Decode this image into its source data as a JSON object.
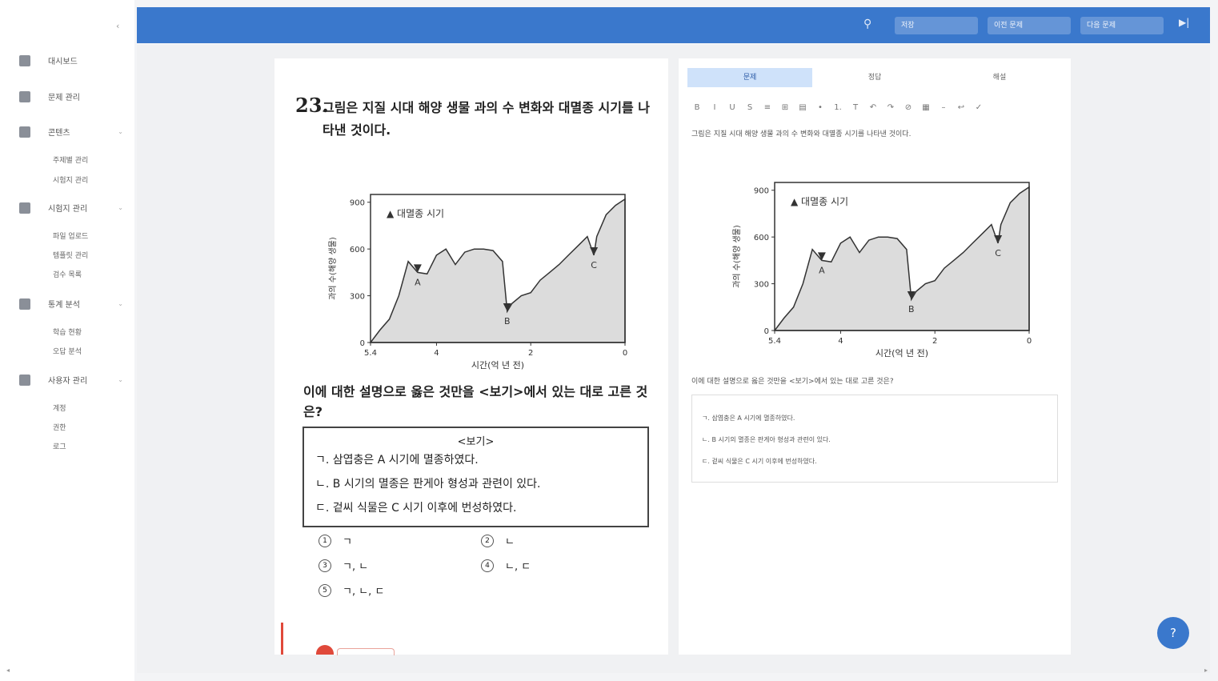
{
  "sidebar": {
    "collapse_glyph": "‹",
    "sections": [
      {
        "label": "대시보드",
        "icon": "dashboard-icon"
      },
      {
        "label": "문제 관리",
        "icon": "user-icon",
        "arrow": ""
      },
      {
        "label": "콘텐츠",
        "icon": "content-icon",
        "arrow": "⌄",
        "subs": [
          "주제별 관리",
          "시험지 관리"
        ]
      },
      {
        "label": "시험지 관리",
        "icon": "document-icon",
        "arrow": "⌄",
        "subs": [
          "파일 업로드",
          "템플릿 관리",
          "검수 목록"
        ]
      },
      {
        "label": "통계 분석",
        "icon": "chart-icon",
        "arrow": "⌄",
        "subs": [
          "학습 현황",
          "오답 분석"
        ]
      },
      {
        "label": "사용자 관리",
        "icon": "settings-icon",
        "arrow": "⌄",
        "subs": [
          "계정",
          "권한",
          "로그"
        ]
      }
    ]
  },
  "topbar": {
    "search_icon": "⚲",
    "buttons": [
      "저장",
      "이전 문제",
      "다음 문제"
    ],
    "next_glyph": "▶|"
  },
  "question": {
    "number": "23.",
    "text": "그림은 지질 시대 해양 생물 과의 수 변화와 대멸종 시기를 나타낸 것이다.",
    "prompt": "이에 대한 설명으로 옳은 것만을 <보기>에서 있는 대로 고른 것은?",
    "box_title": "<보기>",
    "box_lines": [
      "ㄱ. 삼엽충은 A 시기에 멸종하였다.",
      "ㄴ. B 시기의 멸종은 판게아 형성과 관련이 있다.",
      "ㄷ. 겉씨 식물은 C 시기 이후에 번성하였다."
    ],
    "options": [
      {
        "num": "1",
        "text": "ㄱ"
      },
      {
        "num": "2",
        "text": "ㄴ"
      },
      {
        "num": "3",
        "text": "ㄱ, ㄴ"
      },
      {
        "num": "4",
        "text": "ㄴ, ㄷ"
      },
      {
        "num": "5",
        "text": "ㄱ, ㄴ, ㄷ"
      }
    ]
  },
  "editor": {
    "tabs": [
      "문제",
      "정답",
      "해설"
    ],
    "toolbar": [
      "B",
      "I",
      "U",
      "S",
      "≡",
      "⊞",
      "▤",
      "•",
      "1.",
      "T",
      "↶",
      "↷",
      "⊘",
      "▦",
      "–",
      "↩",
      "✓"
    ],
    "body_text": "그림은 지질 시대 해양 생물 과의 수 변화와 대멸종 시기를 나타낸 것이다.",
    "prompt_text": "이에 대한 설명으로 옳은 것만을 <보기>에서 있는 대로 고른 것은?",
    "box_lines": [
      "ㄱ. 삼엽충은 A 시기에 멸종하였다.",
      "ㄴ. B 시기의 멸종은 판게아 형성과 관련이 있다.",
      "ㄷ. 겉씨 식물은 C 시기 이후에 번성하였다."
    ]
  },
  "fab_glyph": "?",
  "scroll_left": "◂",
  "scroll_right": "▸",
  "chart_data": [
    {
      "type": "area",
      "title": "",
      "legend": "▲ 대멸종 시기",
      "xlabel": "시간(억 년 전)",
      "ylabel": "과의 수(해양 생물)",
      "x": [
        5.4,
        5.2,
        5.0,
        4.8,
        4.6,
        4.4,
        4.2,
        4.0,
        3.8,
        3.6,
        3.4,
        3.2,
        3.0,
        2.8,
        2.6,
        2.5,
        2.4,
        2.2,
        2.0,
        1.8,
        1.6,
        1.4,
        1.2,
        1.0,
        0.8,
        0.66,
        0.6,
        0.4,
        0.2,
        0.0
      ],
      "values": [
        0,
        80,
        150,
        300,
        520,
        450,
        440,
        560,
        600,
        500,
        580,
        600,
        600,
        590,
        520,
        200,
        250,
        300,
        320,
        400,
        450,
        500,
        560,
        620,
        680,
        560,
        680,
        820,
        880,
        920
      ],
      "xticks": [
        "5.4",
        "4",
        "2",
        "0"
      ],
      "yticks": [
        "0",
        "300",
        "600",
        "900"
      ],
      "events": [
        "A",
        "B",
        "C"
      ],
      "ylim": [
        0,
        950
      ],
      "xlim": [
        5.4,
        0
      ]
    }
  ]
}
